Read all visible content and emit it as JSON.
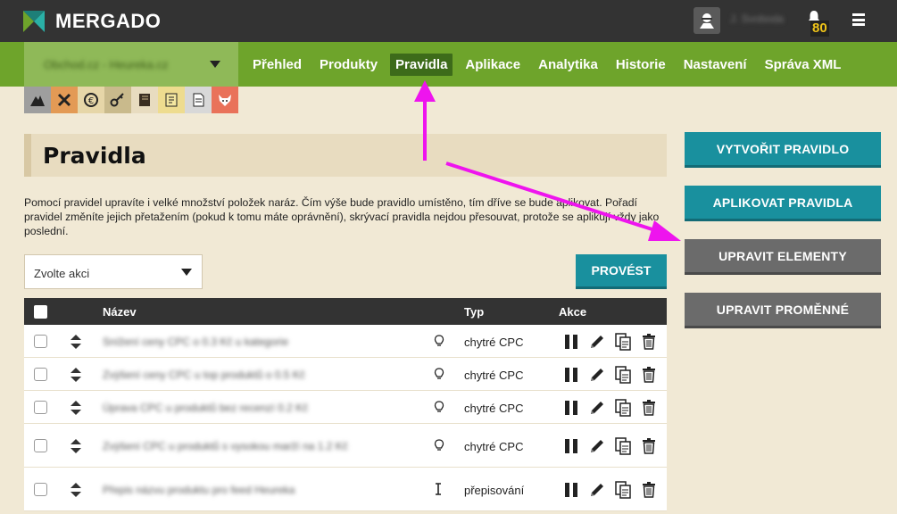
{
  "app": {
    "brand": "MERGADO",
    "notification_count": "80",
    "user_name": "J. Svoboda"
  },
  "shop_select": {
    "value": "Obchod.cz - Heureka.cz"
  },
  "nav": {
    "items": [
      {
        "label": "Přehled",
        "active": false
      },
      {
        "label": "Produkty",
        "active": false
      },
      {
        "label": "Pravidla",
        "active": true
      },
      {
        "label": "Aplikace",
        "active": false
      },
      {
        "label": "Analytika",
        "active": false
      },
      {
        "label": "Historie",
        "active": false
      },
      {
        "label": "Nastavení",
        "active": false
      },
      {
        "label": "Správa XML",
        "active": false
      }
    ]
  },
  "app_icons": [
    "eagle-icon",
    "cross-tools-icon",
    "coin-icon",
    "key-icon",
    "book-icon",
    "notebook-icon",
    "document-icon",
    "fox-icon"
  ],
  "page": {
    "title": "Pravidla",
    "description": "Pomocí pravidel upravíte i velké množství položek naráz. Čím výše bude pravidlo umístěno, tím dříve se bude aplikovat. Pořadí pravidel změníte jejich přetažením (pokud k tomu máte oprávnění), skrývací pravidla nejdou přesouvat, protože se aplikují vždy jako poslední."
  },
  "bulk": {
    "select_placeholder": "Zvolte akci",
    "run_label": "PROVÉST"
  },
  "table": {
    "headers": {
      "name": "Název",
      "type": "Typ",
      "actions": "Akce"
    },
    "rows": [
      {
        "name": "Snížení ceny CPC o 0.3 Kč u kategorie",
        "type": "chytré CPC",
        "hint": "bulb"
      },
      {
        "name": "Zvýšení ceny CPC u top produktů o 0.5 Kč",
        "type": "chytré CPC",
        "hint": "bulb"
      },
      {
        "name": "Úprava CPC u produktů bez recenzí 0.2 Kč",
        "type": "chytré CPC",
        "hint": "bulb"
      },
      {
        "name": "Zvýšení CPC u produktů s vysokou marží na 1.2 Kč",
        "type": "chytré CPC",
        "hint": "bulb"
      },
      {
        "name": "Přepis názvu produktu pro feed Heureka",
        "type": "přepisování",
        "hint": "cursor"
      }
    ]
  },
  "sidebar": {
    "create_rule": "VYTVOŘIT PRAVIDLO",
    "apply_rules": "APLIKOVAT PRAVIDLA",
    "edit_elements": "UPRAVIT ELEMENTY",
    "edit_variables": "UPRAVIT PROMĚNNÉ"
  },
  "colors": {
    "accent_teal": "#19909e",
    "nav_green": "#6ea42b",
    "annotation_arrow": "#ee14ee"
  }
}
